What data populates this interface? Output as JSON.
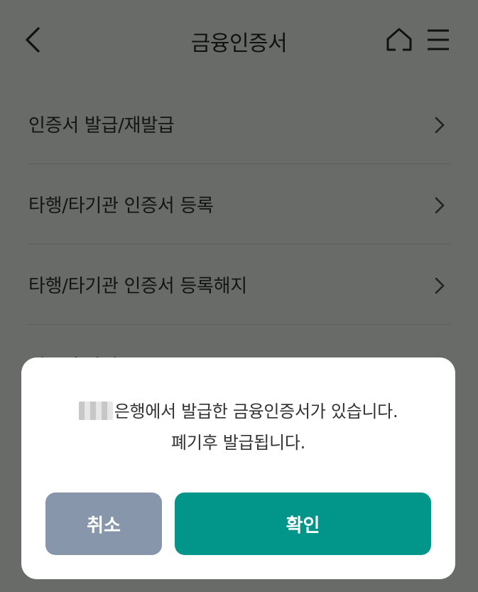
{
  "header": {
    "title": "금융인증서"
  },
  "menu": {
    "items": [
      {
        "label": "인증서 발급/재발급"
      },
      {
        "label": "타행/타기관 인증서 등록"
      },
      {
        "label": "타행/타기관 인증서 등록해지"
      },
      {
        "label": "인증서 관리"
      }
    ]
  },
  "dialog": {
    "message_line1": "은행에서 발급한 금융인증서가 있습니다.",
    "message_line2": "폐기후 발급됩니다.",
    "cancel_label": "취소",
    "confirm_label": "확인"
  },
  "colors": {
    "overlay": "#696b69",
    "cancel_button": "#8796aa",
    "confirm_button": "#02968a"
  },
  "icons": [
    "back-arrow-icon",
    "home-icon",
    "hamburger-menu-icon",
    "chevron-right-icon"
  ]
}
